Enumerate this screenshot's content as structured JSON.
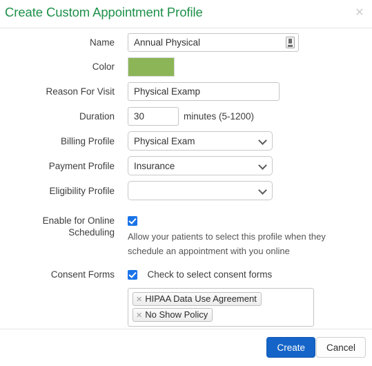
{
  "dialog": {
    "title": "Create Custom Appointment Profile",
    "close_icon": "close-icon",
    "accent_green": "#1e9049",
    "primary_blue": "#1565c8",
    "checkbox_blue": "#1a73e8"
  },
  "fields": {
    "name": {
      "label": "Name",
      "value": "Annual Physical",
      "placeholder": "",
      "trailing_icon": "autofill-icon"
    },
    "color": {
      "label": "Color",
      "value": "#8cb557"
    },
    "reason_for_visit": {
      "label": "Reason For Visit",
      "value": "Physical Examp",
      "placeholder": ""
    },
    "duration": {
      "label": "Duration",
      "value": "30",
      "placeholder": "",
      "units": "minutes (5-1200)"
    },
    "billing_profile": {
      "label": "Billing Profile",
      "value": "Physical Exam",
      "options": [
        "Physical Exam"
      ]
    },
    "payment_profile": {
      "label": "Payment Profile",
      "value": "Insurance",
      "options": [
        "Insurance"
      ]
    },
    "eligibility_profile": {
      "label": "Eligibility Profile",
      "value": "",
      "options": [
        ""
      ]
    },
    "online_scheduling": {
      "label": "Enable for Online Scheduling",
      "checked": true,
      "help": "Allow your patients to select this profile when they schedule an appointment with you online"
    },
    "consent_forms": {
      "label": "Consent Forms",
      "checked": true,
      "checkbox_label": "Check to select consent forms",
      "tags": [
        {
          "remove_icon": "×",
          "label": "HIPAA Data Use Agreement"
        },
        {
          "remove_icon": "×",
          "label": "No Show Policy"
        }
      ]
    }
  },
  "footer": {
    "create_label": "Create",
    "cancel_label": "Cancel"
  }
}
